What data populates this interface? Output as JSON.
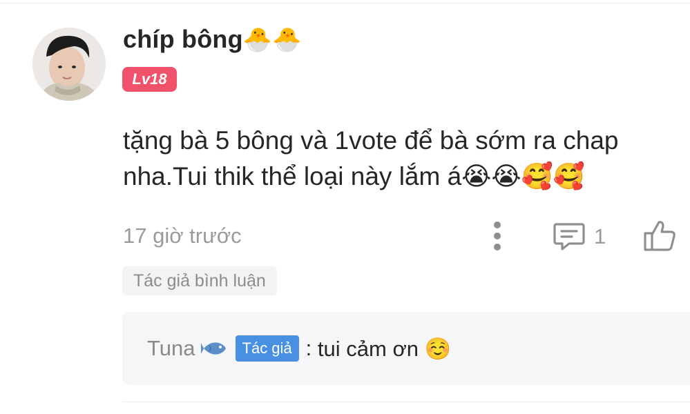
{
  "comment": {
    "username": "chíp bông",
    "username_emojis": "🐣🐣",
    "level": "Lv18",
    "text": "tặng bà 5 bông và 1vote để bà sớm ra chap nha.Tui thik thể loại này lắm á😭😭🥰🥰",
    "timestamp": "17 giờ trước",
    "reply_count": "1",
    "author_tag": "Tác giả bình luận",
    "colors": {
      "level_badge": "#f0526b",
      "author_badge": "#4a90e2"
    }
  },
  "reply": {
    "author": "Tuna",
    "author_icon": "fish-icon",
    "author_badge": "Tác giả",
    "separator": ":",
    "text": "tui cảm ơn ☺️"
  },
  "icons": {
    "more": "more-vertical-icon",
    "reply": "comment-icon",
    "like": "thumbs-up-icon"
  }
}
